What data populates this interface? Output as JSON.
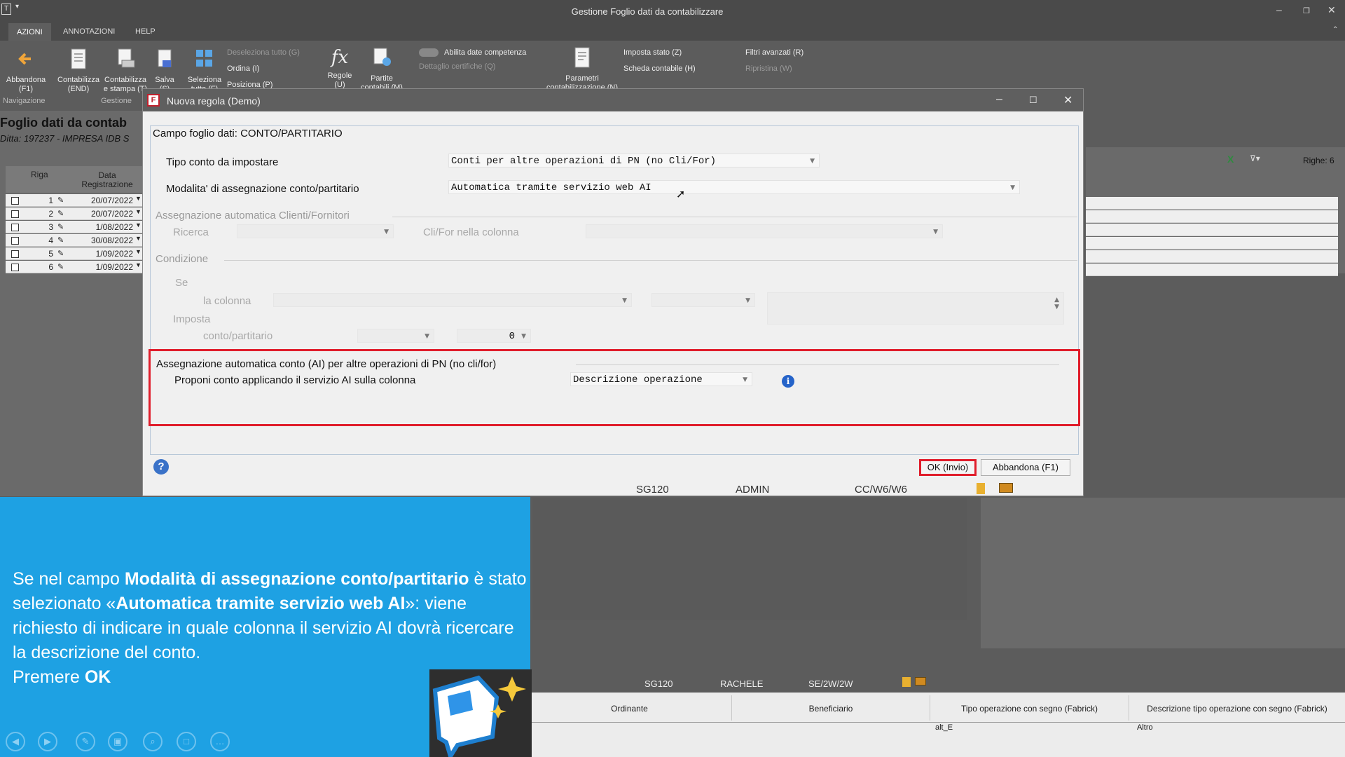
{
  "window": {
    "title": "Gestione Foglio dati da contabilizzare"
  },
  "ribbon": {
    "tabs": [
      "AZIONI",
      "ANNOTAZIONI",
      "HELP"
    ],
    "buttons": {
      "abbandona": "Abbandona\n(F1)",
      "contabilizza": "Contabilizza\n(END)",
      "contabilizza_stampa": "Contabilizza\ne stampa (T)",
      "salva": "Salva\n(S)",
      "seleziona": "Seleziona\ntutto (F)",
      "regole": "Regole\n(U)",
      "partite": "Partite\ncontabili (M)",
      "parametri": "Parametri\ncontabilizzazione (N)"
    },
    "small": {
      "deseleziona": "Deseleziona tutto (G)",
      "ordina": "Ordina (I)",
      "posiziona": "Posiziona (P)",
      "abilita_date": "Abilita date competenza",
      "dettaglio": "Dettaglio certifiche (Q)",
      "imposta_stato": "Imposta stato (Z)",
      "scheda_contabile": "Scheda contabile (H)",
      "filtri_avanzati": "Filtri avanzati (R)",
      "ripristina": "Ripristina (W)"
    },
    "groups": {
      "navigazione": "Navigazione",
      "gestione": "Gestione"
    }
  },
  "background": {
    "title": "Foglio dati da contab",
    "subtitle": "Ditta: 197237 - IMPRESA IDB S",
    "grid_headers": {
      "riga": "Riga",
      "data": "Data\nRegistrazione"
    },
    "rows": [
      {
        "n": "1",
        "date": "20/07/2022"
      },
      {
        "n": "2",
        "date": "20/07/2022"
      },
      {
        "n": "3",
        "date": "1/08/2022"
      },
      {
        "n": "4",
        "date": "30/08/2022"
      },
      {
        "n": "5",
        "date": "1/09/2022"
      },
      {
        "n": "6",
        "date": "1/09/2022"
      }
    ],
    "righe_count": "Righe: 6",
    "bottom_status": {
      "code": "SG120",
      "user": "RACHELE",
      "ref": "SE/2W/2W"
    },
    "bottom_table": {
      "headers": [
        "Ordinante",
        "Beneficiario",
        "Tipo operazione con segno (Fabrick)",
        "Descrizione tipo operazione con segno (Fabrick)"
      ],
      "cells": [
        "alt_E",
        "Altro"
      ]
    }
  },
  "dialog": {
    "title": "Nuova regola  (Demo)",
    "campo": "Campo foglio dati: CONTO/PARTITARIO",
    "tipo_conto_label": "Tipo conto da impostare",
    "tipo_conto_value": "Conti per altre operazioni di PN (no Cli/For)",
    "modalita_label": "Modalita' di assegnazione conto/partitario",
    "modalita_value": "Automatica tramite servizio web AI",
    "sec_clienti": "Assegnazione automatica Clienti/Fornitori",
    "ricerca_label": "Ricerca",
    "cli_for_label": "Cli/For nella colonna",
    "sec_condizione": "Condizione",
    "se_label": "Se",
    "colonna_label": "la colonna",
    "imposta_label": "Imposta",
    "conto_part_label": "conto/partitario",
    "zero_value": "0",
    "sec_ai": "Assegnazione automatica conto (AI) per altre operazioni di PN (no cli/for)",
    "proponi_label": "Proponi conto applicando il servizio AI sulla colonna",
    "proponi_value": "Descrizione operazione",
    "ok_button": "OK (Invio)",
    "cancel_button": "Abbandona (F1)",
    "status": {
      "code": "SG120",
      "user": "ADMIN",
      "ref": "CC/W6/W6"
    }
  },
  "tutorial": {
    "parts": [
      {
        "t": "Se nel  campo ",
        "b": false
      },
      {
        "t": "Modalità di assegnazione conto/partitario",
        "b": true
      },
      {
        "t": " è stato selezionato «",
        "b": false
      },
      {
        "t": "Automatica tramite servizio web AI",
        "b": true
      },
      {
        "t": "»:  viene richiesto di indicare in quale colonna il servizio AI dovrà ricercare la descrizione del conto.",
        "b": false
      },
      {
        "t": "Premere ",
        "b": false,
        "br": true
      },
      {
        "t": "OK",
        "b": true
      }
    ]
  },
  "colors": {
    "accent_red": "#e01d2b",
    "tutorial_blue": "#1ea1e3",
    "info_blue": "#2563c9"
  },
  "icons": [
    "back-arrow-icon",
    "edit-icon",
    "info-icon",
    "help-icon",
    "excel-icon",
    "filter-icon",
    "fx-icon",
    "close-icon",
    "minimize-icon",
    "maximize-icon"
  ]
}
